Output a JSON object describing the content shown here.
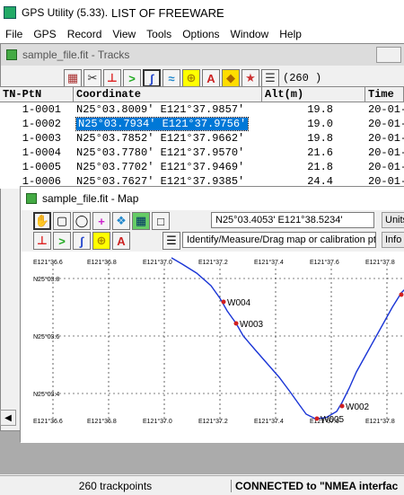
{
  "app": {
    "title": "GPS Utility (5.33).",
    "subtitle": "LIST OF FREEWARE"
  },
  "menu": [
    "File",
    "GPS",
    "Record",
    "View",
    "Tools",
    "Options",
    "Window",
    "Help"
  ],
  "tracks": {
    "title": "sample_file.fit - Tracks",
    "count": "(260 )",
    "columns": [
      "TN-PtN",
      "Coordinate",
      "Alt(m)",
      "Time"
    ],
    "rows": [
      [
        "1-0001",
        "N25°03.8009' E121°37.9857'",
        "19.8",
        "20-01-"
      ],
      [
        "1-0002",
        "N25°03.7934' E121°37.9756'",
        "19.0",
        "20-01-"
      ],
      [
        "1-0003",
        "N25°03.7852' E121°37.9662'",
        "19.8",
        "20-01-"
      ],
      [
        "1-0004",
        "N25°03.7780' E121°37.9570'",
        "21.6",
        "20-01-"
      ],
      [
        "1-0005",
        "N25°03.7702' E121°37.9469'",
        "21.8",
        "20-01-"
      ],
      [
        "1-0006",
        "N25°03.7627' E121°37.9385'",
        "24.4",
        "20-01-"
      ]
    ]
  },
  "map": {
    "title": "sample_file.fit - Map",
    "coordinate": "N25°03.4053' E121°38.5234'",
    "status": "Identify/Measure/Drag map or calibration pt.",
    "units_label": "Units",
    "info_label": "Info",
    "x_ticks": [
      "E121°36.6",
      "E121°36.8",
      "E121°37.0",
      "E121°37.2",
      "E121°37.4",
      "E121°37.6",
      "E121°37.8"
    ],
    "y_ticks": [
      "N25°03.8",
      "N25°03.6",
      "N25°03.4"
    ],
    "waypoints": [
      "W004",
      "W003",
      "W002",
      "W005"
    ]
  },
  "status": {
    "trackpoints": "260 trackpoints",
    "connection": "CONNECTED to \"NMEA interfac"
  },
  "colors": {
    "track": "#1a35d6",
    "waypoint": "#d02020",
    "selection": "#0078d7"
  }
}
